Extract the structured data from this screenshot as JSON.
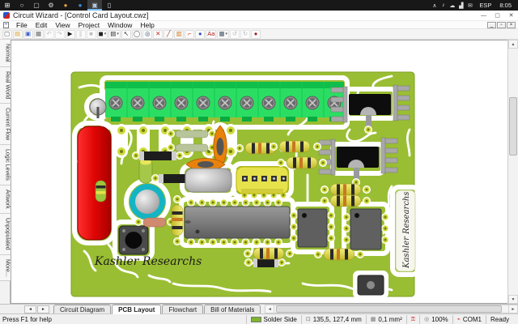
{
  "taskbar": {
    "language": "ESP",
    "time": "8:05",
    "left_icons": [
      {
        "name": "start",
        "glyph": "⊞",
        "color": "#ffffff"
      },
      {
        "name": "search",
        "glyph": "○",
        "color": "#dddddd"
      },
      {
        "name": "task-view",
        "glyph": "▢",
        "color": "#dddddd"
      },
      {
        "name": "settings",
        "glyph": "⚙",
        "color": "#dddddd"
      },
      {
        "name": "browser-chrome",
        "glyph": "●",
        "color": "#e0a23c"
      },
      {
        "name": "browser-edge",
        "glyph": "●",
        "color": "#3f8fd8"
      },
      {
        "name": "circuit-wizard-app",
        "glyph": "▣",
        "color": "#b8c8e0",
        "active": true
      },
      {
        "name": "phone",
        "glyph": "▯",
        "color": "#dddddd"
      }
    ],
    "tray_icons": [
      {
        "name": "tray-chevron",
        "glyph": "∧"
      },
      {
        "name": "volume",
        "glyph": "♪"
      },
      {
        "name": "onedrive",
        "glyph": "☁"
      },
      {
        "name": "network",
        "glyph": "▟"
      },
      {
        "name": "chat",
        "glyph": "✉"
      }
    ]
  },
  "titlebar": {
    "title": "Circuit Wizard - [Control Card Layout.cwz]",
    "minimize": "—",
    "maximize": "▢",
    "close": "✕"
  },
  "menubar": {
    "items": [
      "File",
      "Edit",
      "View",
      "Project",
      "Window",
      "Help"
    ],
    "mdi_minimize": "_",
    "mdi_restore": "▫",
    "mdi_close": "×"
  },
  "toolbar": {
    "buttons": [
      {
        "name": "new",
        "glyph": "▢",
        "color": "#555555"
      },
      {
        "name": "open",
        "glyph": "▤",
        "color": "#d8a12c"
      },
      {
        "name": "save",
        "glyph": "▣",
        "color": "#3a5fc8"
      },
      {
        "name": "print",
        "glyph": "▦",
        "color": "#666666"
      },
      {
        "name": "undo",
        "glyph": "↶",
        "disabled": true
      },
      {
        "name": "redo",
        "glyph": "↷",
        "disabled": true
      },
      {
        "name": "run",
        "glyph": "▶",
        "color": "#111111"
      },
      {
        "name": "pause",
        "glyph": "∥",
        "disabled": true
      },
      {
        "name": "stop",
        "glyph": "■",
        "disabled": true
      },
      {
        "name": "component-mode",
        "glyph": "◼",
        "color": "#222222",
        "dropdown": true
      },
      {
        "name": "view-mode",
        "glyph": "▤",
        "color": "#222222",
        "dropdown": true
      },
      {
        "name": "select-tool",
        "glyph": "↖",
        "color": "#333333"
      },
      {
        "name": "pan-tool",
        "glyph": "◯",
        "color": "#555555"
      },
      {
        "name": "zoom-tool",
        "glyph": "◎",
        "color": "#335577"
      },
      {
        "name": "delete-tool",
        "glyph": "✕",
        "color": "#cc2222"
      },
      {
        "name": "wire-tool",
        "glyph": "╱",
        "color": "#a33333"
      },
      {
        "name": "gallery",
        "glyph": "▥",
        "color": "#c7791f"
      },
      {
        "name": "autoroute",
        "glyph": "⌐",
        "color": "#cc2200"
      },
      {
        "name": "bead-tool",
        "glyph": "●",
        "color": "#2a52c0"
      },
      {
        "name": "text-tool",
        "glyph": "Aa",
        "color": "#b02222"
      },
      {
        "name": "grid",
        "glyph": "▦",
        "color": "#445566",
        "dropdown": true
      },
      {
        "name": "rotate-left",
        "glyph": "↺",
        "disabled": true
      },
      {
        "name": "rotate-right",
        "glyph": "↻",
        "disabled": true
      },
      {
        "name": "publish",
        "glyph": "●",
        "color": "#a02020"
      }
    ]
  },
  "side_tabs": {
    "items": [
      "Normal",
      "Real World",
      "Current Flow",
      "Logic Levels",
      "Artwork",
      "Unpopulated",
      "More..."
    ]
  },
  "pcb": {
    "silkscreen_text": "Kashler Researchs",
    "side_label_text": "Kashler Researchs",
    "board_color": "#9abe33",
    "terminal_color": "#2bde63",
    "trace_color": "#ffffff"
  },
  "bottom_tabs": {
    "tabs": [
      {
        "name": "circuit-diagram",
        "label": "Circuit Diagram"
      },
      {
        "name": "pcb-layout",
        "label": "PCB Layout",
        "active": true
      },
      {
        "name": "flowchart",
        "label": "Flowchart"
      },
      {
        "name": "bill-of-materials",
        "label": "Bill of Materials"
      }
    ]
  },
  "statusbar": {
    "help": "Press F1 for help",
    "layer": "Solder Side",
    "layer_color": "#7db52c",
    "coordinates": "135,5, 127,4 mm",
    "area": "0,1 mm²",
    "zoom": "100%",
    "com_port": "COM1",
    "state": "Ready"
  }
}
